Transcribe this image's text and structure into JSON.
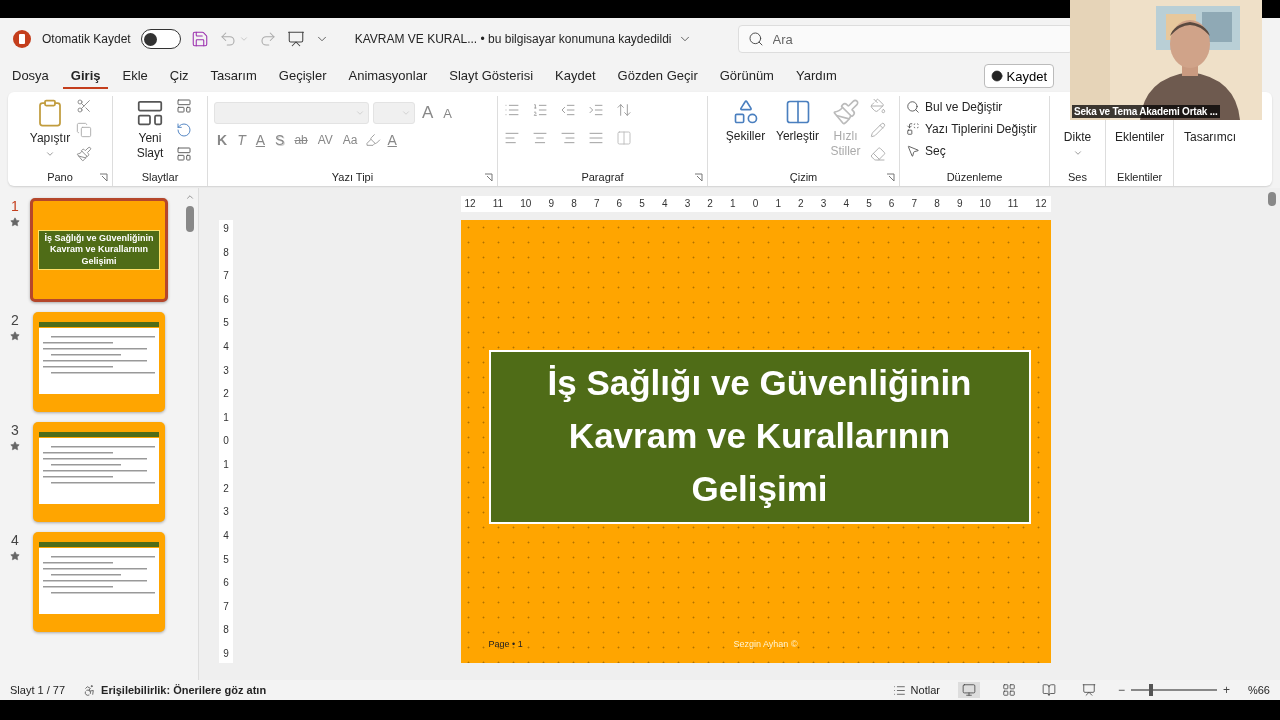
{
  "title_bar": {
    "autosave_label": "Otomatik Kaydet",
    "autosave_on": false,
    "document_title": "KAVRAM VE KURAL...",
    "save_status": "• bu bilgisayar konumuna kaydedildi",
    "search_placeholder": "Ara"
  },
  "menu_tabs": [
    {
      "label": "Dosya",
      "selected": false
    },
    {
      "label": "Giriş",
      "selected": true
    },
    {
      "label": "Ekle",
      "selected": false
    },
    {
      "label": "Çiz",
      "selected": false
    },
    {
      "label": "Tasarım",
      "selected": false
    },
    {
      "label": "Geçişler",
      "selected": false
    },
    {
      "label": "Animasyonlar",
      "selected": false
    },
    {
      "label": "Slayt Gösterisi",
      "selected": false
    },
    {
      "label": "Kaydet",
      "selected": false
    },
    {
      "label": "Gözden Geçir",
      "selected": false
    },
    {
      "label": "Görünüm",
      "selected": false
    },
    {
      "label": "Yardım",
      "selected": false
    }
  ],
  "record_button": "Kaydet",
  "ribbon": {
    "pano": {
      "label": "Pano",
      "paste": "Yapıştır"
    },
    "slaytlar": {
      "label": "Slaytlar",
      "new_slide": "Yeni Slayt"
    },
    "yazi_tipi": {
      "label": "Yazı Tipi",
      "size_buttons": [
        {
          "text": "A",
          "kind": "grow"
        },
        {
          "text": "A",
          "kind": "shrink"
        }
      ],
      "format_buttons": [
        {
          "text": "K",
          "kind": "bold"
        },
        {
          "text": "T",
          "kind": "italic"
        },
        {
          "text": "A",
          "kind": "underline"
        },
        {
          "text": "S",
          "kind": "shadow"
        },
        {
          "text": "ab",
          "kind": "strike"
        },
        {
          "text": "AV",
          "kind": "spacing"
        },
        {
          "text": "Aa",
          "kind": "case"
        }
      ],
      "font_color": "A"
    },
    "paragraf": {
      "label": "Paragraf"
    },
    "cizim": {
      "label": "Çizim",
      "buttons": [
        {
          "label": "Şekiller",
          "kind": "shapes",
          "disabled": false
        },
        {
          "label": "Yerleştir",
          "kind": "arrange",
          "disabled": false
        },
        {
          "label": "Hızlı Stiller",
          "kind": "styles",
          "disabled": true
        }
      ]
    },
    "duzenleme": {
      "label": "Düzenleme",
      "items": [
        {
          "label": "Bul ve Değiştir",
          "kind": "find"
        },
        {
          "label": "Yazı Tiplerini Değiştir",
          "kind": "fonts"
        },
        {
          "label": "Seç",
          "kind": "select"
        }
      ]
    },
    "ses": {
      "label": "Ses",
      "button": "Dikte"
    },
    "eklentiler": {
      "label": "Eklentiler",
      "button": "Eklentiler"
    },
    "designer": {
      "button": "Tasarımcı"
    }
  },
  "thumbnails": [
    {
      "number": "1",
      "selected": true,
      "kind": "title",
      "title": "İş Sağlığı ve Güvenliğinin Kavram ve Kurallarının Gelişimi"
    },
    {
      "number": "2",
      "selected": false,
      "kind": "content"
    },
    {
      "number": "3",
      "selected": false,
      "kind": "content"
    },
    {
      "number": "4",
      "selected": false,
      "kind": "content"
    }
  ],
  "horizontal_ruler": [
    "12",
    "11",
    "10",
    "9",
    "8",
    "7",
    "6",
    "5",
    "4",
    "3",
    "2",
    "1",
    "0",
    "1",
    "2",
    "3",
    "4",
    "5",
    "6",
    "7",
    "8",
    "9",
    "10",
    "11",
    "12"
  ],
  "vertical_ruler": [
    "9",
    "8",
    "7",
    "6",
    "5",
    "4",
    "3",
    "2",
    "1",
    "0",
    "1",
    "2",
    "3",
    "4",
    "5",
    "6",
    "7",
    "8",
    "9"
  ],
  "slide": {
    "title": "İş Sağlığı ve Güvenliğinin Kavram ve Kurallarının Gelişimi",
    "page": "Page • 1",
    "author": "Sezgin Ayhan ©"
  },
  "status_bar": {
    "slide_counter": "Slayt 1 / 77",
    "accessibility": "Erişilebilirlik: Önerilere göz atın",
    "notes": "Notlar",
    "views": [
      {
        "kind": "normal",
        "selected": true
      },
      {
        "kind": "sorter",
        "selected": false
      },
      {
        "kind": "reading",
        "selected": false
      },
      {
        "kind": "show",
        "selected": false
      }
    ],
    "zoom": {
      "minus": "−",
      "level": 0.23,
      "plus": "+",
      "reading": "%66"
    }
  },
  "video_overlay": {
    "caption": "Seka ve Tema Akademi Ortak ..."
  }
}
